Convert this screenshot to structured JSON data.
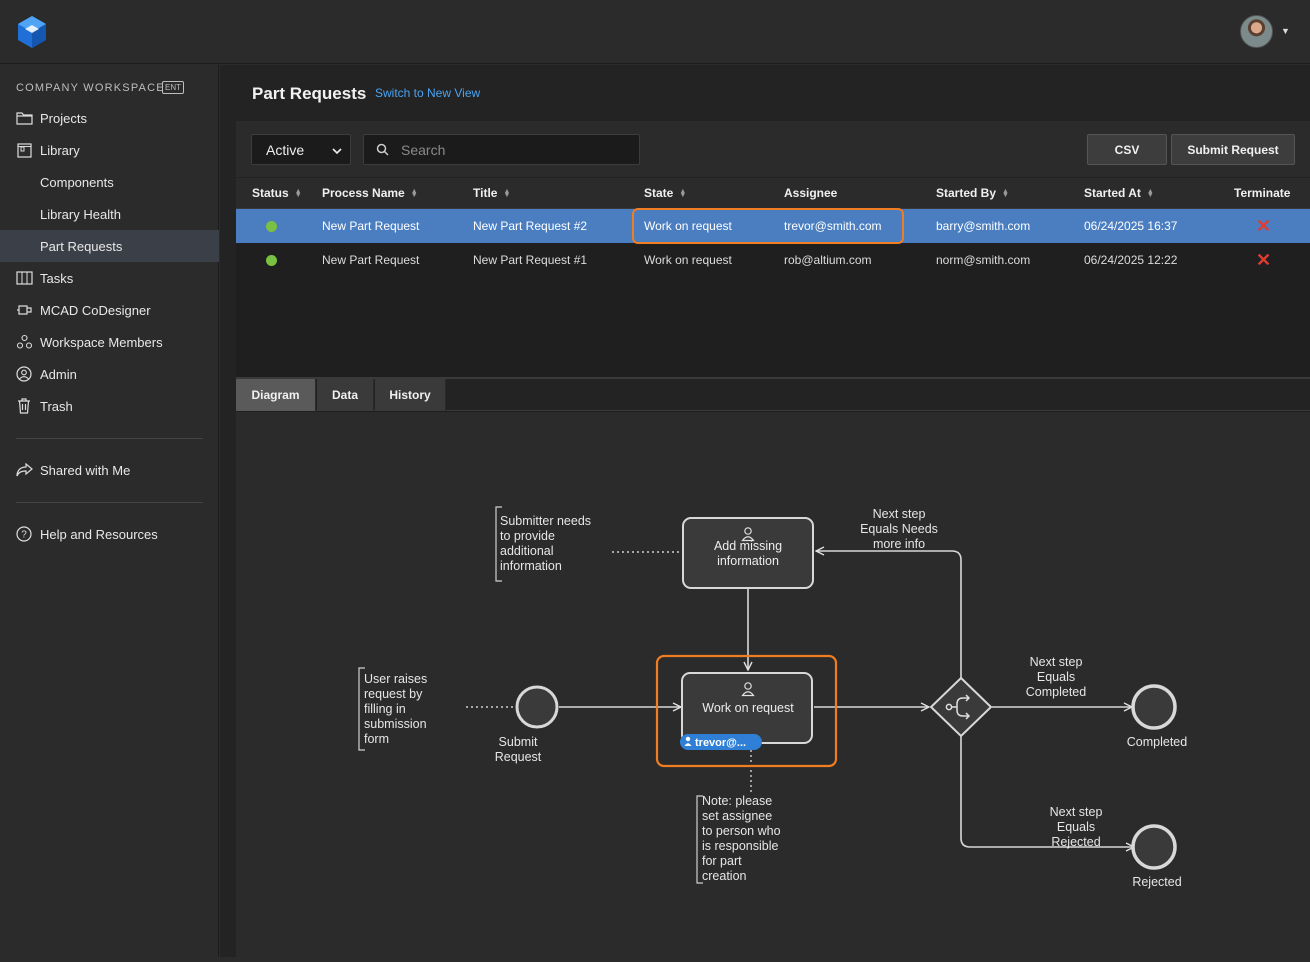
{
  "sidebar": {
    "workspace_label": "COMPANY WORKSPACE",
    "workspace_badge": "ENT",
    "items": [
      {
        "label": "Projects"
      },
      {
        "label": "Library"
      },
      {
        "label": "Components"
      },
      {
        "label": "Library Health"
      },
      {
        "label": "Part Requests"
      },
      {
        "label": "Tasks"
      },
      {
        "label": "MCAD CoDesigner"
      },
      {
        "label": "Workspace Members"
      },
      {
        "label": "Admin"
      },
      {
        "label": "Trash"
      },
      {
        "label": "Shared with Me"
      },
      {
        "label": "Help and Resources"
      }
    ]
  },
  "header": {
    "title": "Part Requests",
    "switch_link": "Switch to New View"
  },
  "toolbar": {
    "filter_value": "Active",
    "search_placeholder": "Search",
    "csv_label": "CSV",
    "submit_label": "Submit Request"
  },
  "table": {
    "columns": [
      "Status",
      "Process Name",
      "Title",
      "State",
      "Assignee",
      "Started By",
      "Started At",
      "Terminate"
    ],
    "rows": [
      {
        "status_color": "#7ac143",
        "process_name": "New Part Request",
        "title": "New Part Request #2",
        "state": "Work on request",
        "assignee": "trevor@smith.com",
        "started_by": "barry@smith.com",
        "started_at": "06/24/2025 16:37",
        "terminate": "✕"
      },
      {
        "status_color": "#7ac143",
        "process_name": "New Part Request",
        "title": "New Part Request #1",
        "state": "Work on request",
        "assignee": "rob@altium.com",
        "started_by": "norm@smith.com",
        "started_at": "06/24/2025 12:22",
        "terminate": "✕"
      }
    ]
  },
  "tabs": [
    {
      "label": "Diagram"
    },
    {
      "label": "Data"
    },
    {
      "label": "History"
    }
  ],
  "diagram": {
    "note_submitter": [
      "Submitter needs",
      "to provide",
      "additional",
      "information"
    ],
    "add_missing": [
      "Add missing",
      "information"
    ],
    "next_more_info": [
      "Next step",
      "Equals Needs",
      "more info"
    ],
    "note_user": [
      "User raises",
      "request by",
      "filling in",
      "submission",
      "form"
    ],
    "submit_request": [
      "Submit",
      "Request"
    ],
    "work_on_request": "Work on request",
    "assignee_badge": "trevor@...",
    "next_completed": [
      "Next step",
      "Equals",
      "Completed"
    ],
    "completed": "Completed",
    "next_rejected": [
      "Next step",
      "Equals",
      "Rejected"
    ],
    "rejected": "Rejected",
    "note_assignee": [
      "Note: please",
      "set assignee",
      "to person who",
      "is responsible",
      "for part",
      "creation"
    ]
  },
  "colors": {
    "accent_orange": "#ef7d22",
    "selected_row": "#4a7ec0",
    "link_blue": "#4aa3f0",
    "status_green": "#7ac143",
    "terminate_red": "#e03c31"
  }
}
